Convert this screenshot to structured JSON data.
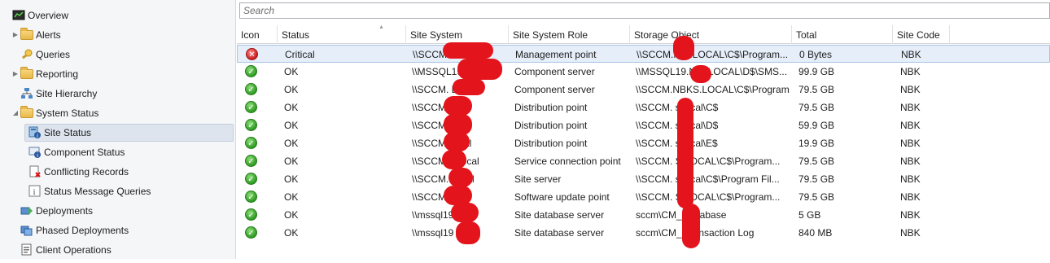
{
  "nav": {
    "items": [
      {
        "label": "Overview",
        "icon": "overview-icon",
        "indent": 0,
        "twisty": "",
        "selected": false
      },
      {
        "label": "Alerts",
        "icon": "folder-icon",
        "indent": 1,
        "twisty": "▶",
        "selected": false
      },
      {
        "label": "Queries",
        "icon": "queries-icon",
        "indent": 1,
        "twisty": "",
        "selected": false
      },
      {
        "label": "Reporting",
        "icon": "folder-icon",
        "indent": 1,
        "twisty": "▶",
        "selected": false
      },
      {
        "label": "Site Hierarchy",
        "icon": "site-hierarchy-icon",
        "indent": 1,
        "twisty": "",
        "selected": false
      },
      {
        "label": "System Status",
        "icon": "folder-icon",
        "indent": 1,
        "twisty": "◢",
        "selected": false
      },
      {
        "label": "Site Status",
        "icon": "site-status-icon",
        "indent": 2,
        "twisty": "",
        "selected": true
      },
      {
        "label": "Component Status",
        "icon": "component-status-icon",
        "indent": 2,
        "twisty": "",
        "selected": false
      },
      {
        "label": "Conflicting Records",
        "icon": "conflicting-records-icon",
        "indent": 2,
        "twisty": "",
        "selected": false
      },
      {
        "label": "Status Message Queries",
        "icon": "status-message-queries-icon",
        "indent": 2,
        "twisty": "",
        "selected": false
      },
      {
        "label": "Deployments",
        "icon": "deployments-icon",
        "indent": 1,
        "twisty": "",
        "selected": false
      },
      {
        "label": "Phased Deployments",
        "icon": "phased-deployments-icon",
        "indent": 1,
        "twisty": "",
        "selected": false
      },
      {
        "label": "Client Operations",
        "icon": "client-operations-icon",
        "indent": 1,
        "twisty": "",
        "selected": false
      }
    ]
  },
  "search": {
    "placeholder": "Search",
    "value": ""
  },
  "grid": {
    "columns": [
      "Icon",
      "Status",
      "Site System",
      "Site System Role",
      "Storage Object",
      "Total",
      "Site Code"
    ],
    "rows": [
      {
        "icon": "critical-icon",
        "status": "Critical",
        "site_system": "\\\\SCCM",
        "role": "Management point",
        "storage": "\\\\SCCM.N      S.LOCAL\\C$\\Program...",
        "total": "0 Bytes",
        "site_code": "NBK",
        "selected": true
      },
      {
        "icon": "ok-icon",
        "status": "OK",
        "site_system": "\\\\MSSQL19",
        "role": "Component server",
        "storage": "\\\\MSSQL19.N      S.LOCAL\\D$\\SMS...",
        "total": "99.9 GB",
        "site_code": "NBK",
        "selected": false
      },
      {
        "icon": "ok-icon",
        "status": "OK",
        "site_system": "\\\\SCCM.        LOCAL",
        "role": "Component server",
        "storage": "\\\\SCCM.NBKS.LOCAL\\C$\\Program...",
        "total": "79.5 GB",
        "site_code": "NBK",
        "selected": false
      },
      {
        "icon": "ok-icon",
        "status": "OK",
        "site_system": "\\\\SCCM        .local",
        "role": "Distribution point",
        "storage": "\\\\SCCM.      s.local\\C$",
        "total": "79.5 GB",
        "site_code": "NBK",
        "selected": false
      },
      {
        "icon": "ok-icon",
        "status": "OK",
        "site_system": "\\\\SCCM        .local",
        "role": "Distribution point",
        "storage": "\\\\SCCM.      s.local\\D$",
        "total": "59.9 GB",
        "site_code": "NBK",
        "selected": false
      },
      {
        "icon": "ok-icon",
        "status": "OK",
        "site_system": "\\\\SCCM        .local",
        "role": "Distribution point",
        "storage": "\\\\SCCM.      s.local\\E$",
        "total": "19.9 GB",
        "site_code": "NBK",
        "selected": false
      },
      {
        "icon": "ok-icon",
        "status": "OK",
        "site_system": "\\\\SCCM.        s.local",
        "role": "Service connection point",
        "storage": "\\\\SCCM.      S.LOCAL\\C$\\Program...",
        "total": "79.5 GB",
        "site_code": "NBK",
        "selected": false
      },
      {
        "icon": "ok-icon",
        "status": "OK",
        "site_system": "\\\\SCCM.        .local",
        "role": "Site server",
        "storage": "\\\\SCCM.      s.local\\C$\\Program Fil...",
        "total": "79.5 GB",
        "site_code": "NBK",
        "selected": false
      },
      {
        "icon": "ok-icon",
        "status": "OK",
        "site_system": "\\\\SCCM        .local",
        "role": "Software update point",
        "storage": "\\\\SCCM.      S.LOCAL\\C$\\Program...",
        "total": "79.5 GB",
        "site_code": "NBK",
        "selected": false
      },
      {
        "icon": "ok-icon",
        "status": "OK",
        "site_system": "\\\\mssql19        local",
        "role": "Site database server",
        "storage": "sccm\\CM_        Database",
        "total": "5 GB",
        "site_code": "NBK",
        "selected": false
      },
      {
        "icon": "ok-icon",
        "status": "OK",
        "site_system": "\\\\mssql19        local",
        "role": "Site database server",
        "storage": "sccm\\CM_        Transaction Log",
        "total": "840 MB",
        "site_code": "NBK",
        "selected": false
      }
    ]
  },
  "colors": {
    "ok": "#2f9a23",
    "critical": "#c81e1e",
    "redaction": "#e3141b",
    "selection": "#e5eef9"
  }
}
